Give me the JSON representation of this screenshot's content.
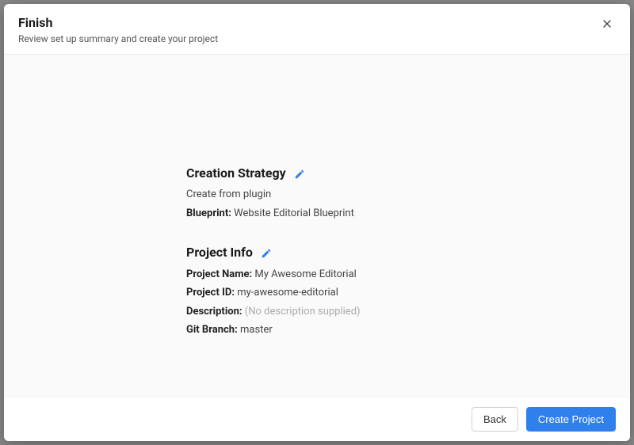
{
  "header": {
    "title": "Finish",
    "subtitle": "Review set up summary and create your project"
  },
  "strategy": {
    "title": "Creation Strategy",
    "subtext": "Create from plugin",
    "blueprint_label": "Blueprint:",
    "blueprint_value": "Website Editorial Blueprint"
  },
  "project": {
    "title": "Project Info",
    "name_label": "Project Name:",
    "name_value": "My Awesome Editorial",
    "id_label": "Project ID:",
    "id_value": "my-awesome-editorial",
    "desc_label": "Description:",
    "desc_value": "(No description supplied)",
    "branch_label": "Git Branch:",
    "branch_value": "master"
  },
  "footer": {
    "back": "Back",
    "create": "Create Project"
  }
}
